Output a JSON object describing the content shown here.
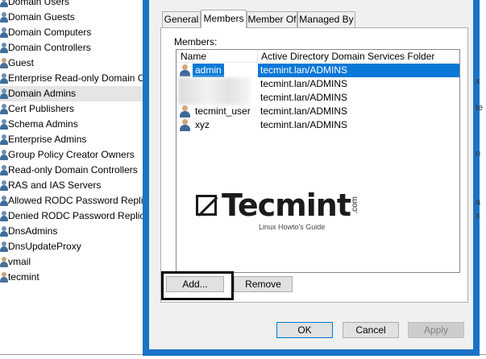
{
  "background_list": {
    "items": [
      {
        "label": "Domain Users",
        "type": "group"
      },
      {
        "label": "Domain Guests",
        "type": "group"
      },
      {
        "label": "Domain Computers",
        "type": "group"
      },
      {
        "label": "Domain Controllers",
        "type": "group"
      },
      {
        "label": "Guest",
        "type": "user"
      },
      {
        "label": "Enterprise Read-only Domain Co",
        "type": "group"
      },
      {
        "label": "Domain Admins",
        "type": "group",
        "selected": true
      },
      {
        "label": "Cert Publishers",
        "type": "group"
      },
      {
        "label": "Schema Admins",
        "type": "group"
      },
      {
        "label": "Enterprise Admins",
        "type": "group"
      },
      {
        "label": "Group Policy Creator Owners",
        "type": "group"
      },
      {
        "label": "Read-only Domain Controllers",
        "type": "group"
      },
      {
        "label": "RAS and IAS Servers",
        "type": "group"
      },
      {
        "label": "Allowed RODC Password Replica",
        "type": "group"
      },
      {
        "label": "Denied RODC Password Replicat",
        "type": "group"
      },
      {
        "label": "DnsAdmins",
        "type": "group"
      },
      {
        "label": "DnsUpdateProxy",
        "type": "group"
      },
      {
        "label": "vmail",
        "type": "user"
      },
      {
        "label": "tecmint",
        "type": "user"
      }
    ]
  },
  "dialog": {
    "tabs": [
      {
        "label": "General"
      },
      {
        "label": "Members",
        "active": true
      },
      {
        "label": "Member Of"
      },
      {
        "label": "Managed By"
      }
    ],
    "members_label": "Members:",
    "columns": {
      "name": "Name",
      "folder": "Active Directory Domain Services Folder"
    },
    "members": [
      {
        "name": "admin",
        "folder": "tecmint.lan/ADMINS",
        "selected": true
      },
      {
        "name": "",
        "folder": "tecmint.lan/ADMINS",
        "redacted": true
      },
      {
        "name": "",
        "folder": "tecmint.lan/ADMINS",
        "redacted": true
      },
      {
        "name": "tecmint_user",
        "folder": "tecmint.lan/ADMINS"
      },
      {
        "name": "xyz",
        "folder": "tecmint.lan/ADMINS"
      }
    ],
    "watermark": {
      "brand": "Tecmint",
      "suffix": ".com",
      "tagline": "Linux Howto's Guide"
    },
    "buttons": {
      "add": "Add...",
      "remove": "Remove",
      "ok": "OK",
      "cancel": "Cancel",
      "apply": "Apply"
    }
  },
  "colors": {
    "title_bar": "#1a73c7",
    "selection": "#0a78d7"
  }
}
